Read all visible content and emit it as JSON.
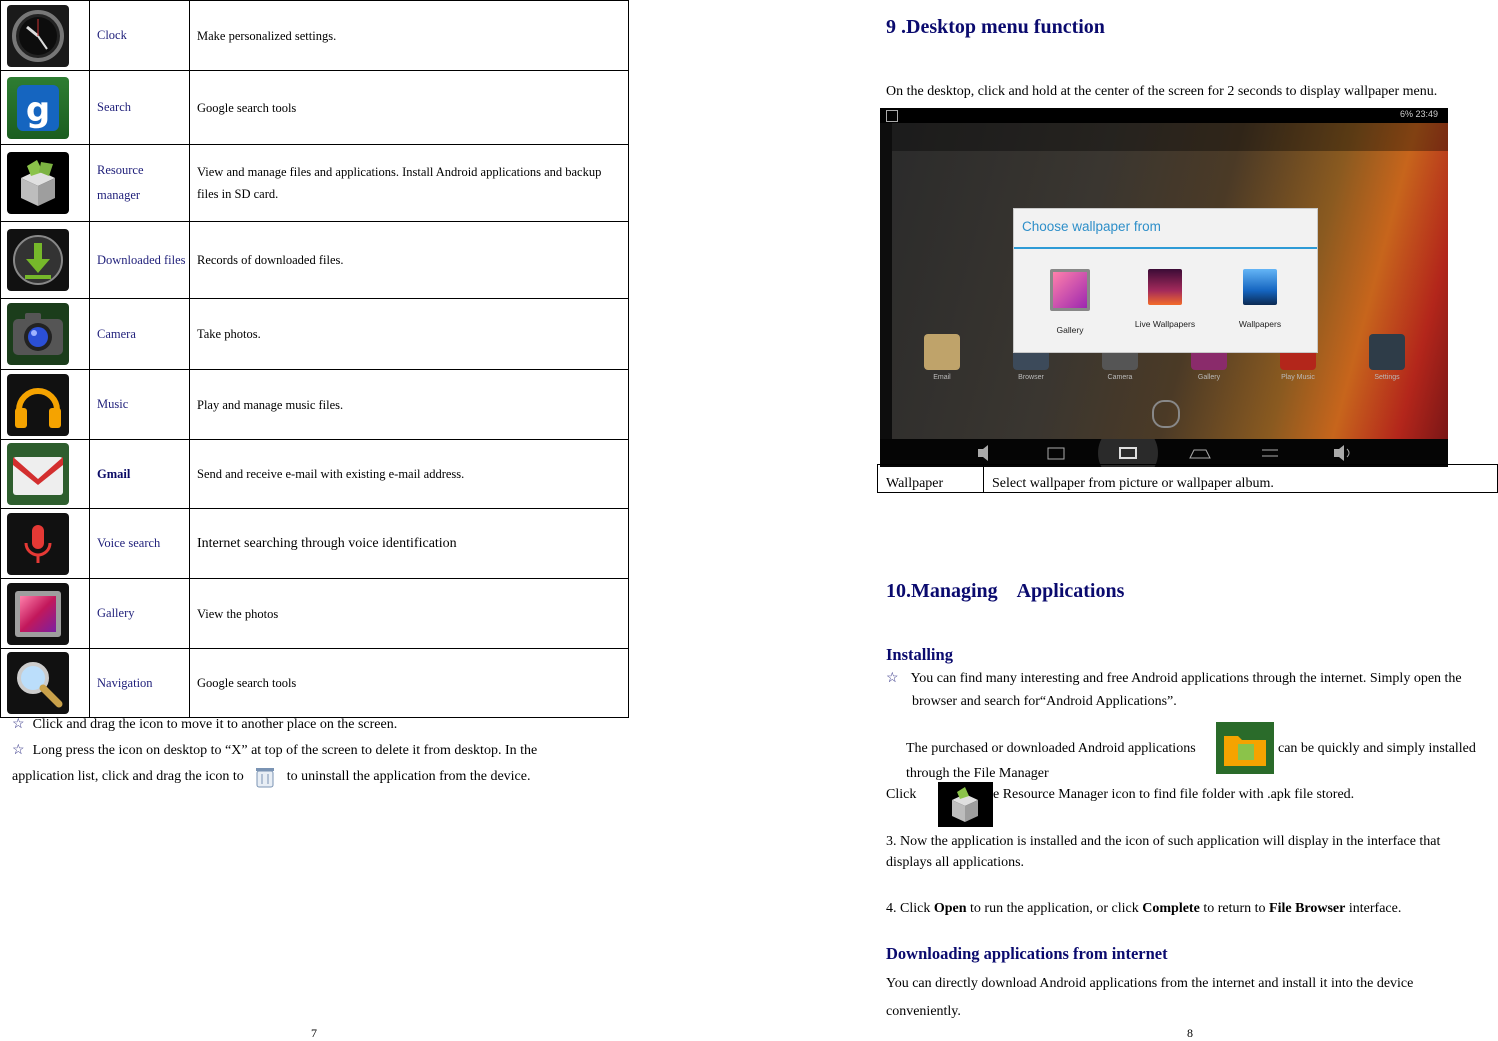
{
  "left_page": {
    "apps": [
      {
        "icon": "clock-icon",
        "name": "Clock",
        "description": "Make personalized settings."
      },
      {
        "icon": "google-search-icon",
        "name": "Search",
        "description": "Google search tools"
      },
      {
        "icon": "resource-manager-icon",
        "name": "Resource manager",
        "description": "View and manage files and applications. Install Android applications and backup files in SD card."
      },
      {
        "icon": "download-icon",
        "name": "Downloaded files",
        "description": "Records of downloaded files."
      },
      {
        "icon": "camera-icon",
        "name": "Camera",
        "description": "Take photos."
      },
      {
        "icon": "headphones-icon",
        "name": "Music",
        "description": "Play and manage music files."
      },
      {
        "icon": "gmail-icon",
        "name": "Gmail",
        "description": "Send and receive e-mail with existing e-mail address."
      },
      {
        "icon": "microphone-icon",
        "name": "Voice search",
        "description": "Internet searching through voice identification"
      },
      {
        "icon": "gallery-icon",
        "name": "Gallery",
        "description": "View the photos"
      },
      {
        "icon": "magnifier-icon",
        "name": "Navigation",
        "description": "Google search tools"
      }
    ],
    "note1": "Click and drag the icon to move it to another place on the screen.",
    "note2_a": "Long press the icon on desktop to “X” at top of the screen to delete it from desktop. In the",
    "note2_b": "application list, click and drag the icon to",
    "note2_c": "to uninstall the application from the device.",
    "star": "☆",
    "page_number": "7"
  },
  "right_page": {
    "section9_title": "9 .Desktop menu function",
    "section9_text": "On the desktop, click and hold at the center of the screen for 2 seconds to display wallpaper menu.",
    "screenshot": {
      "status_time": "6%  23:49",
      "dialog_title": "Choose wallpaper from",
      "options": [
        "Gallery",
        "Live Wallpapers",
        "Wallpapers"
      ],
      "dock_labels": [
        "Email",
        "Browser",
        "Camera",
        "Gallery",
        "Play Music",
        "Settings"
      ]
    },
    "wallpaper_table": {
      "label": "Wallpaper",
      "description": "Select wallpaper from picture or wallpaper album."
    },
    "section10_title": "10.Managing    Applications",
    "installing_heading": "Installing",
    "install_bullet_1": "You can find many interesting and free Android applications through the internet. Simply open the",
    "install_bullet_2": "browser and search for“Android Applications”.",
    "purchased_a": "The purchased or downloaded Android applications",
    "purchased_b": "can be quickly and simply installed",
    "purchased_c": "through the File Manager",
    "click_a": "Click",
    "click_b": "e Resource Manager icon to find file folder with .apk file stored.",
    "step3_a": "3. Now the application is installed and the icon of such application will display in the interface that",
    "step3_b": "displays all applications.",
    "step4_prefix": "4. Click ",
    "step4_open": "Open",
    "step4_mid": " to run the application, or click ",
    "step4_complete": "Complete",
    "step4_mid2": " to return to ",
    "step4_filebrowser": "File Browser",
    "step4_suffix": " interface.",
    "downloading_heading": "Downloading applications from internet",
    "downloading_text_a": "You can directly download Android applications from the internet and install it into the device",
    "downloading_text_b": "conveniently.",
    "page_number": "8"
  }
}
